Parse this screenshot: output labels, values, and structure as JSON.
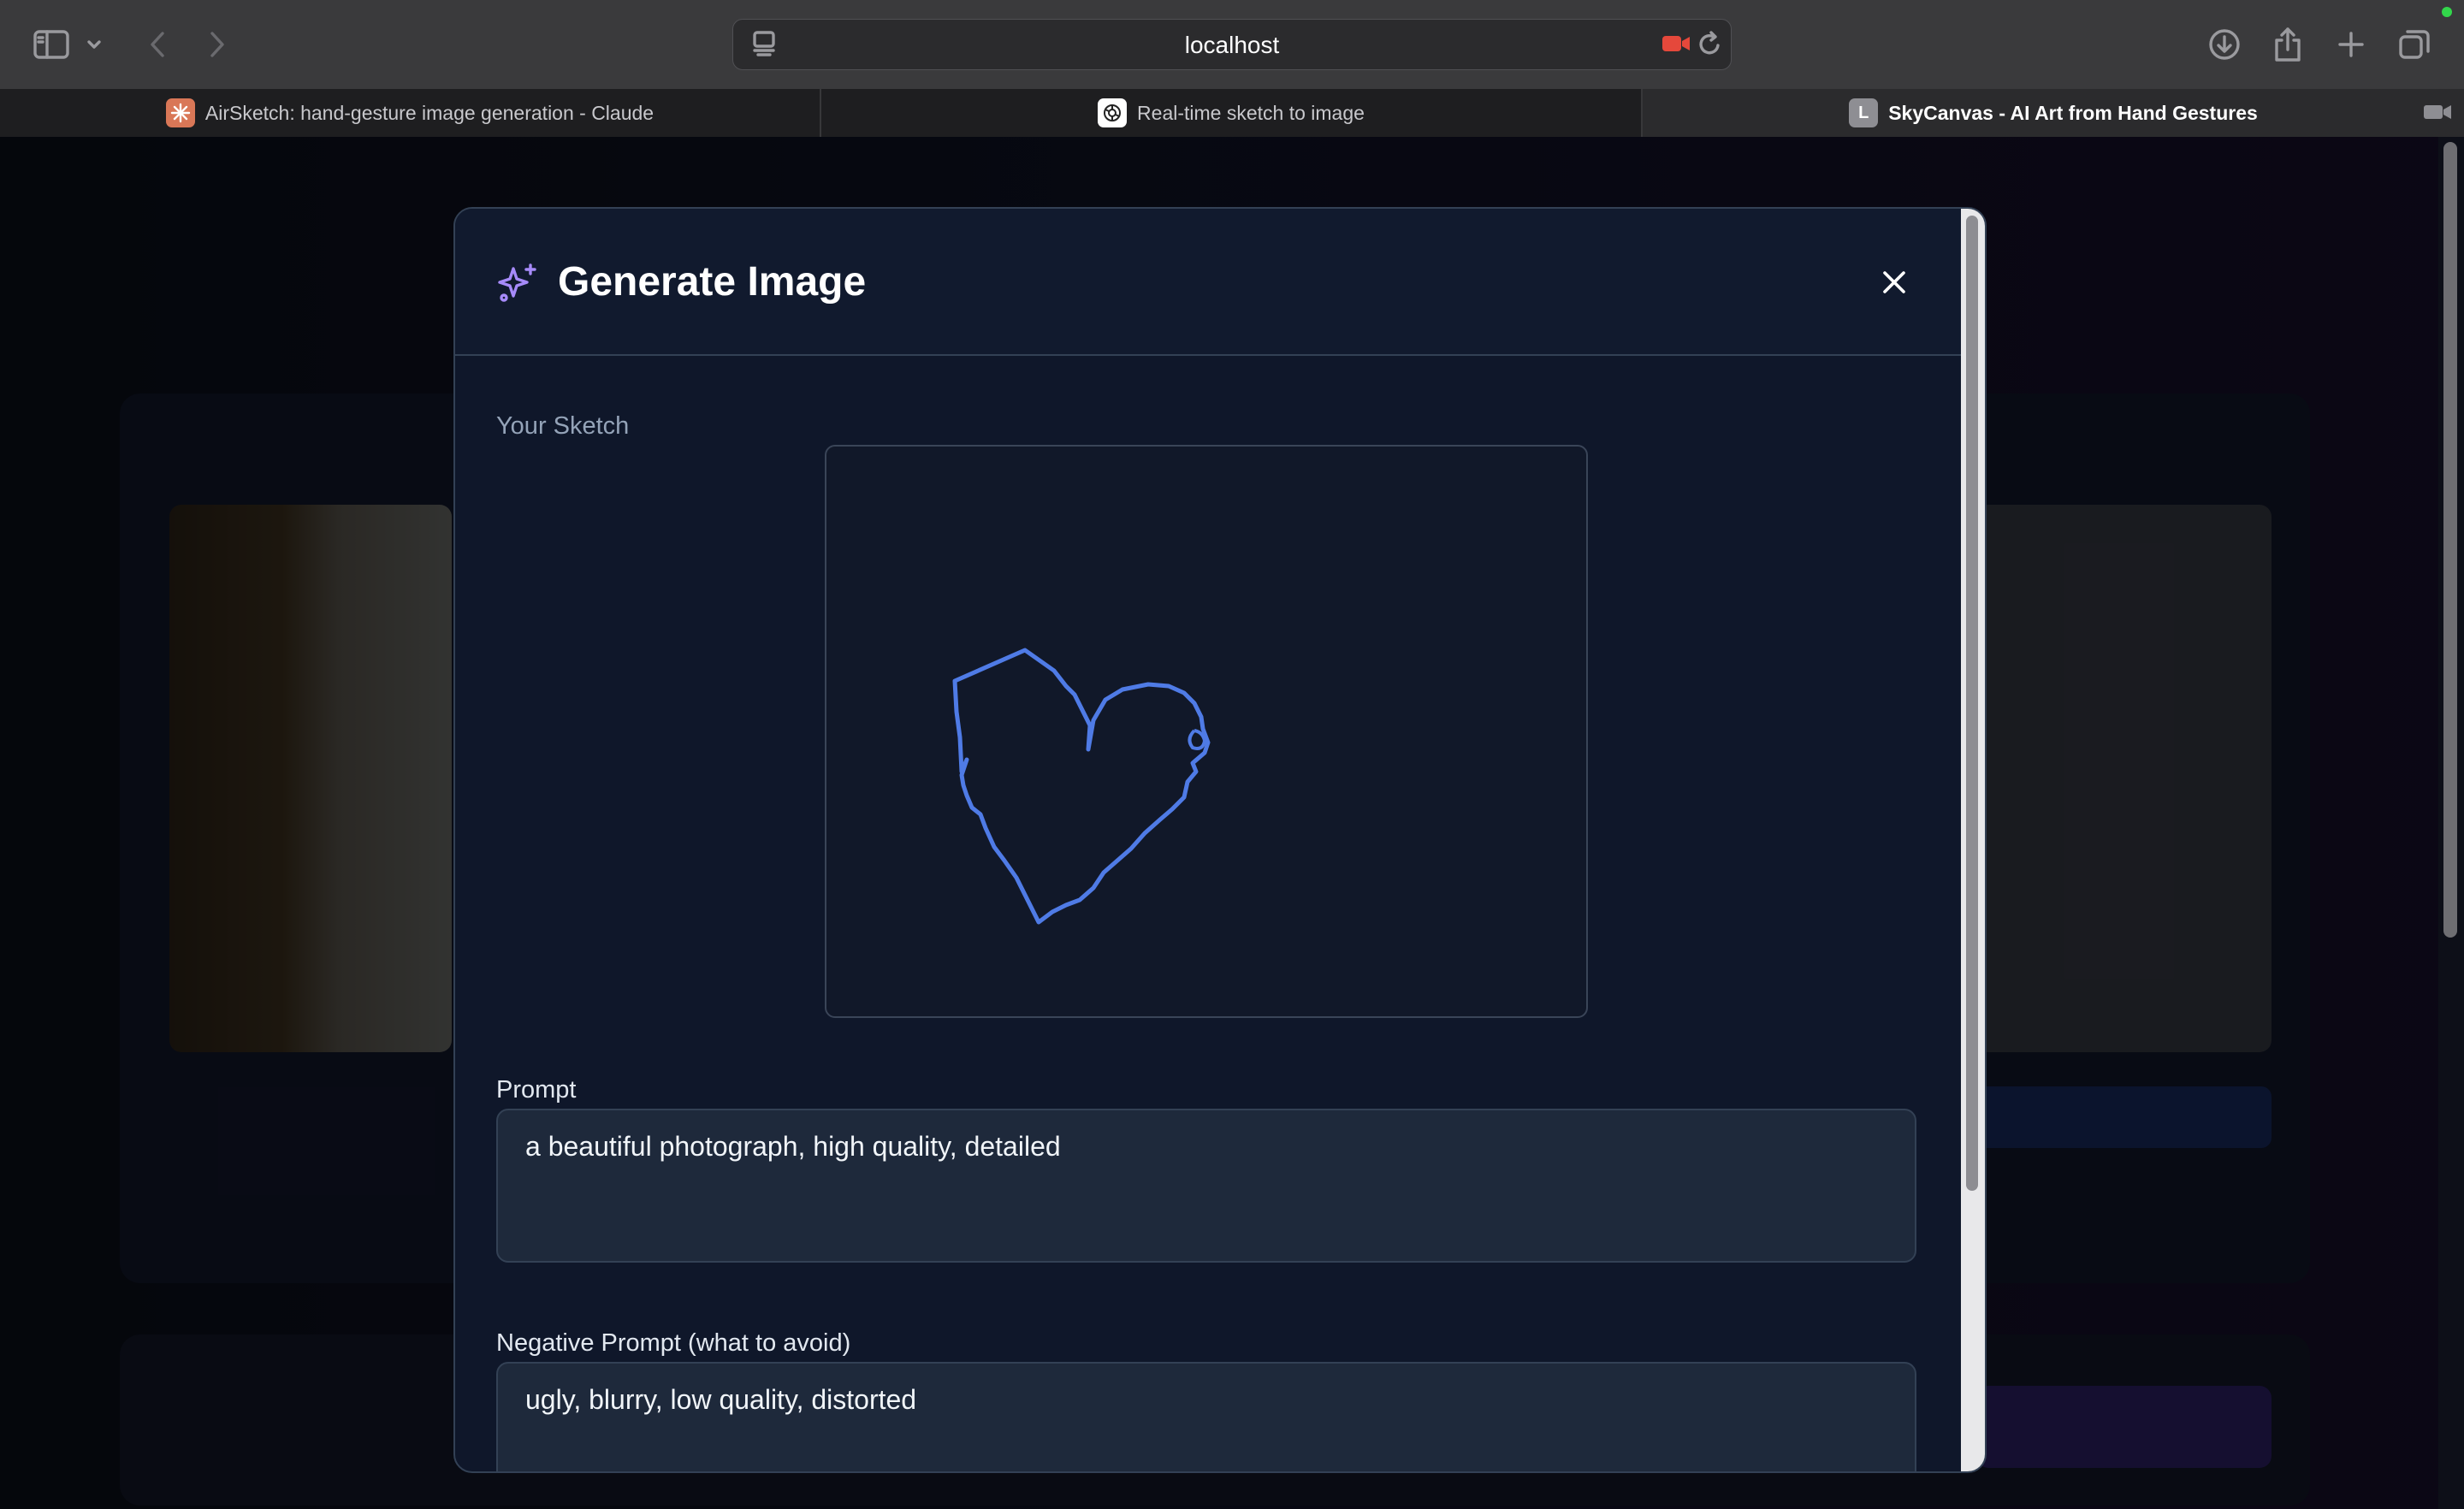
{
  "browser": {
    "url": "localhost",
    "tabs": [
      {
        "title": "AirSketch: hand-gesture image generation - Claude",
        "favicon": "claude-icon",
        "active": false
      },
      {
        "title": "Real-time sketch to image",
        "favicon": "openai-icon",
        "active": false
      },
      {
        "title": "SkyCanvas - AI Art from Hand Gestures",
        "favicon": "L",
        "active": true
      }
    ]
  },
  "modal": {
    "title": "Generate Image",
    "title_icon": "sparkle-icon",
    "sketch_label": "Your Sketch",
    "prompt_label": "Prompt",
    "prompt_value": "a beautiful photograph, high quality, detailed",
    "negative_label": "Negative Prompt (what to avoid)",
    "negative_value": "ugly, blurry, low quality, distorted"
  },
  "colors": {
    "accent_purple": "#a78bfa",
    "sketch_stroke": "#4f7be6",
    "modal_bg": "#0f172a",
    "field_bg": "#1e293b"
  }
}
